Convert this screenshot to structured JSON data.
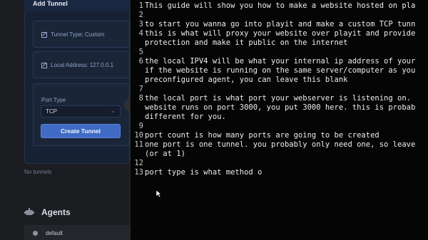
{
  "tunnel_form": {
    "title": "Add Tunnel",
    "tunnel_type": "Tunnel Type: Custom",
    "local_address": "Local Address: 127.0.0.1",
    "port_type_label": "Port Type",
    "port_type_value": "TCP",
    "create_button": "Create Tunnel"
  },
  "no_tunnels": "No tunnels",
  "agents": {
    "title": "Agents",
    "items": [
      {
        "name": "default"
      }
    ]
  },
  "editor": {
    "lines": [
      {
        "num": "1",
        "text": "This guide will show you how to make a website hosted on pla"
      },
      {
        "num": "2",
        "text": ""
      },
      {
        "num": "3",
        "text": "to start you wanna go into playit and make a custom TCP tunn"
      },
      {
        "num": "4",
        "text": "this is what will proxy your website over playit and provide"
      },
      {
        "num": "",
        "text": "protection and make it public on the internet"
      },
      {
        "num": "5",
        "text": ""
      },
      {
        "num": "6",
        "text": "the local IPV4 will be what your internal ip address of your"
      },
      {
        "num": "",
        "text": "if the website is running on the same server/computer as you"
      },
      {
        "num": "",
        "text": "preconfigured agent, you can leave this blank"
      },
      {
        "num": "7",
        "text": ""
      },
      {
        "num": "8",
        "text": "the local port is what port your webserver is listening on."
      },
      {
        "num": "",
        "text": "website runs on port 3000, you put 3000 here. this is probab"
      },
      {
        "num": "",
        "text": "different for you."
      },
      {
        "num": "9",
        "text": ""
      },
      {
        "num": "10",
        "text": "port count is how many ports are going to be created"
      },
      {
        "num": "11",
        "text": "one port is one tunnel. you probably only need one, so leave"
      },
      {
        "num": "",
        "text": "(or at 1)"
      },
      {
        "num": "12",
        "text": ""
      },
      {
        "num": "13",
        "text": "port type is what method o"
      }
    ]
  }
}
